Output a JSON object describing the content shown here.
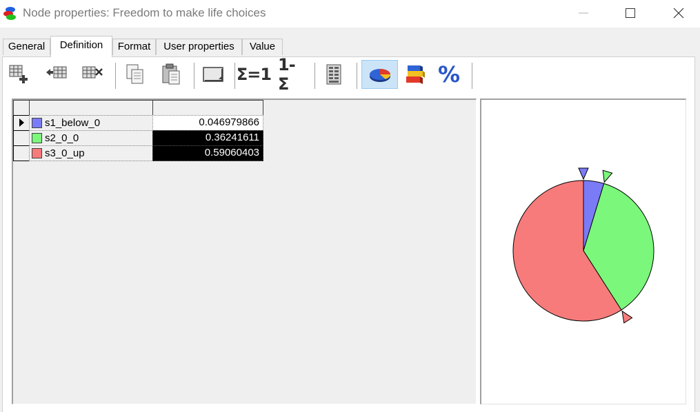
{
  "window": {
    "title": "Node properties: Freedom to make life choices",
    "icon": "genie-node-icon"
  },
  "tabs": [
    {
      "label": "General",
      "active": false
    },
    {
      "label": "Definition",
      "active": true
    },
    {
      "label": "Format",
      "active": false
    },
    {
      "label": "User properties",
      "active": false
    },
    {
      "label": "Value",
      "active": false
    }
  ],
  "toolbar": {
    "buttons": [
      {
        "name": "add-row",
        "icon": "grid-add-icon"
      },
      {
        "name": "insert-row",
        "icon": "grid-insert-icon"
      },
      {
        "name": "delete-row",
        "icon": "grid-delete-icon"
      },
      {
        "name": "copy",
        "icon": "copy-icon"
      },
      {
        "name": "paste",
        "icon": "paste-icon"
      },
      {
        "name": "enlarge-cell",
        "icon": "window-icon"
      },
      {
        "name": "normalize",
        "label": "Σ=1"
      },
      {
        "name": "complement",
        "label": "1-Σ"
      },
      {
        "name": "calculator",
        "icon": "calculator-icon"
      },
      {
        "name": "pie-chart",
        "icon": "pie-chart-icon",
        "pressed": true
      },
      {
        "name": "bar-chart",
        "icon": "bar-chart-icon"
      },
      {
        "name": "percent",
        "label": "%"
      }
    ],
    "sigma_one": "Σ=1",
    "one_minus_sigma": "1-Σ",
    "percent": "%"
  },
  "table": {
    "header": [
      "",
      ""
    ],
    "rows": [
      {
        "state": "s1_below_0",
        "value": "0.046979866",
        "color": "#7b7bf7",
        "selected": false
      },
      {
        "state": "s2_0_0",
        "value": "0.36241611",
        "color": "#7bf77b",
        "selected": true
      },
      {
        "state": "s3_0_up",
        "value": "0.59060403",
        "color": "#f77b7b",
        "selected": true
      }
    ]
  },
  "chart_data": {
    "type": "pie",
    "categories": [
      "s1_below_0",
      "s2_0_0",
      "s3_0_up"
    ],
    "values": [
      0.046979866,
      0.36241611,
      0.59060403
    ],
    "colors": [
      "#7b7bf7",
      "#7bf77b",
      "#f77b7b"
    ]
  }
}
